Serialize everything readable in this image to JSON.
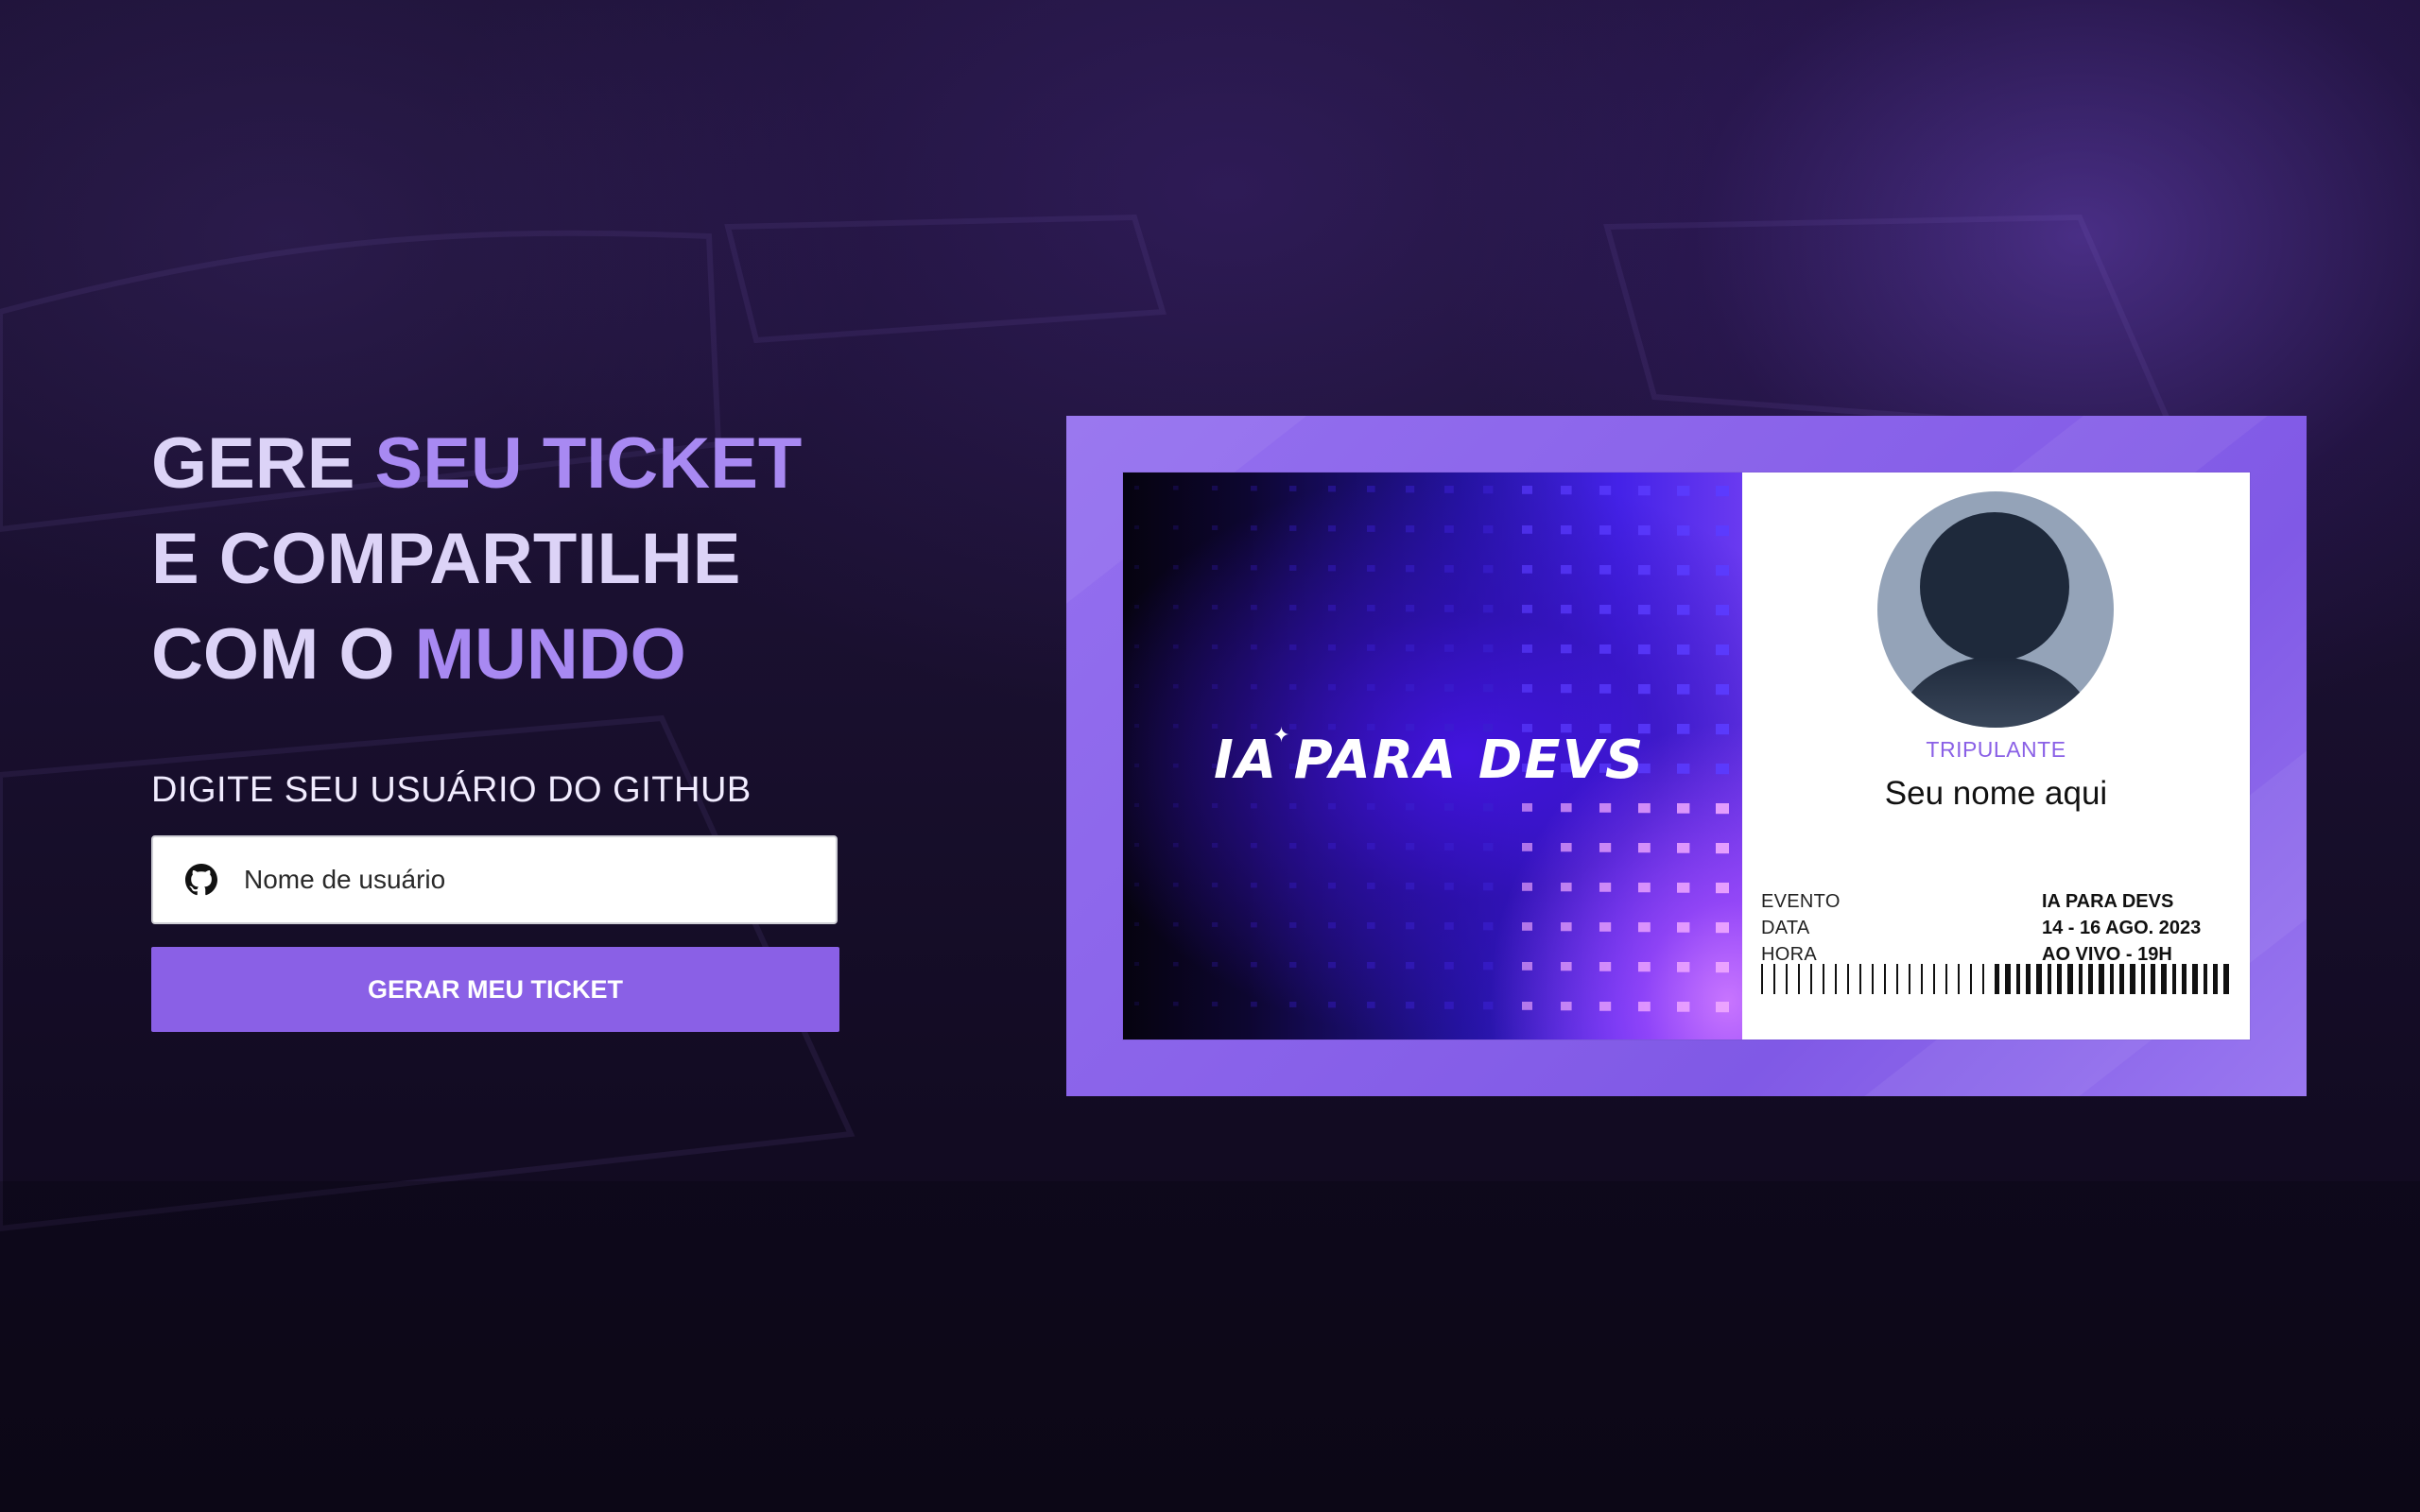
{
  "hero": {
    "headline_lines": [
      [
        {
          "text": "GERE ",
          "accent": false
        },
        {
          "text": "SEU TICKET",
          "accent": true
        }
      ],
      [
        {
          "text": "E COMPARTILHE",
          "accent": false
        }
      ],
      [
        {
          "text": "COM O ",
          "accent": false
        },
        {
          "text": "MUNDO",
          "accent": true
        }
      ]
    ],
    "prompt_label": "DIGITE SEU USUÁRIO DO GITHUB",
    "input_placeholder": "Nome de usuário",
    "input_value": "",
    "input_icon": "github-icon",
    "cta_label": "GERAR MEU TICKET"
  },
  "ticket": {
    "brand": "IA PARA DEVS",
    "brand_prefix": "IA",
    "brand_suffix": "PARA DEVS",
    "role": "TRIPULANTE",
    "name": "Seu nome aqui",
    "labels": [
      "EVENTO",
      "DATA",
      "HORA"
    ],
    "values": [
      "IA PARA DEVS",
      "14 - 16 AGO. 2023",
      "AO VIVO - 19H"
    ]
  },
  "colors": {
    "accent": "#8a60e6",
    "headline_light": "#dcd3f7",
    "headline_accent": "#a889f2",
    "background": "#1a1030"
  }
}
